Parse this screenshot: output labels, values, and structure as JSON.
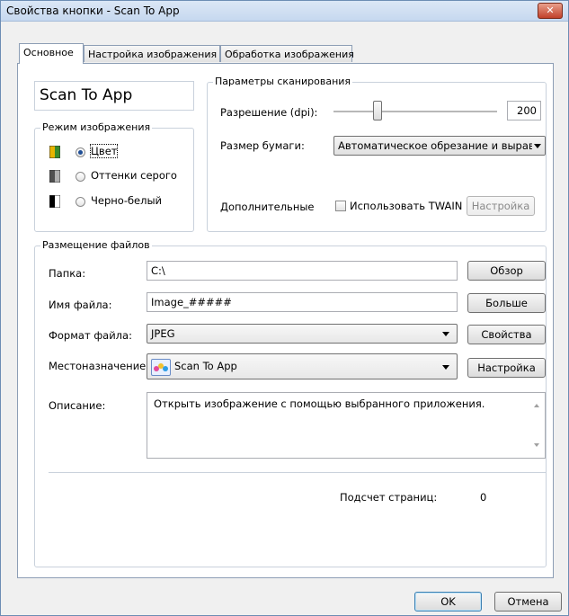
{
  "window": {
    "title": "Свойства кнопки - Scan To App",
    "close_glyph": "✕"
  },
  "tabs": [
    {
      "label": "Основное",
      "active": true
    },
    {
      "label": "Настройка изображения",
      "active": false
    },
    {
      "label": "Обработка изображения",
      "active": false
    }
  ],
  "button_name": "Scan To App",
  "image_mode": {
    "title": "Режим изображения",
    "options": [
      {
        "label": "Цвет",
        "selected": true,
        "icon": "color-mode-icon"
      },
      {
        "label": "Оттенки серого",
        "selected": false,
        "icon": "grayscale-mode-icon"
      },
      {
        "label": "Черно-белый",
        "selected": false,
        "icon": "bw-mode-icon"
      }
    ]
  },
  "scan_params": {
    "title": "Параметры сканирования",
    "resolution_label": "Разрешение (dpi):",
    "resolution_value": "200",
    "paper_label": "Размер бумаги:",
    "paper_value": "Автоматическое обрезание и выравн",
    "additional_label": "Дополнительные",
    "twain_label": "Использовать TWAIN",
    "twain_checked": false,
    "settings_button": "Настройка"
  },
  "file_placement": {
    "title": "Размещение файлов",
    "folder_label": "Папка:",
    "folder_value": "C:\\",
    "browse_button": "Обзор",
    "filename_label": "Имя файла:",
    "filename_value": "Image_#####",
    "more_button": "Больше",
    "format_label": "Формат файла:",
    "format_value": "JPEG",
    "properties_button": "Свойства",
    "destination_label": "Местоназначение:",
    "destination_value": "Scan To App",
    "destination_button": "Настройка",
    "description_label": "Описание:",
    "description_value": "Открыть изображение с помощью выбранного приложения.",
    "page_count_label": "Подсчет страниц:",
    "page_count_value": "0"
  },
  "footer": {
    "ok_button": "OK",
    "cancel_button": "Отмена"
  }
}
